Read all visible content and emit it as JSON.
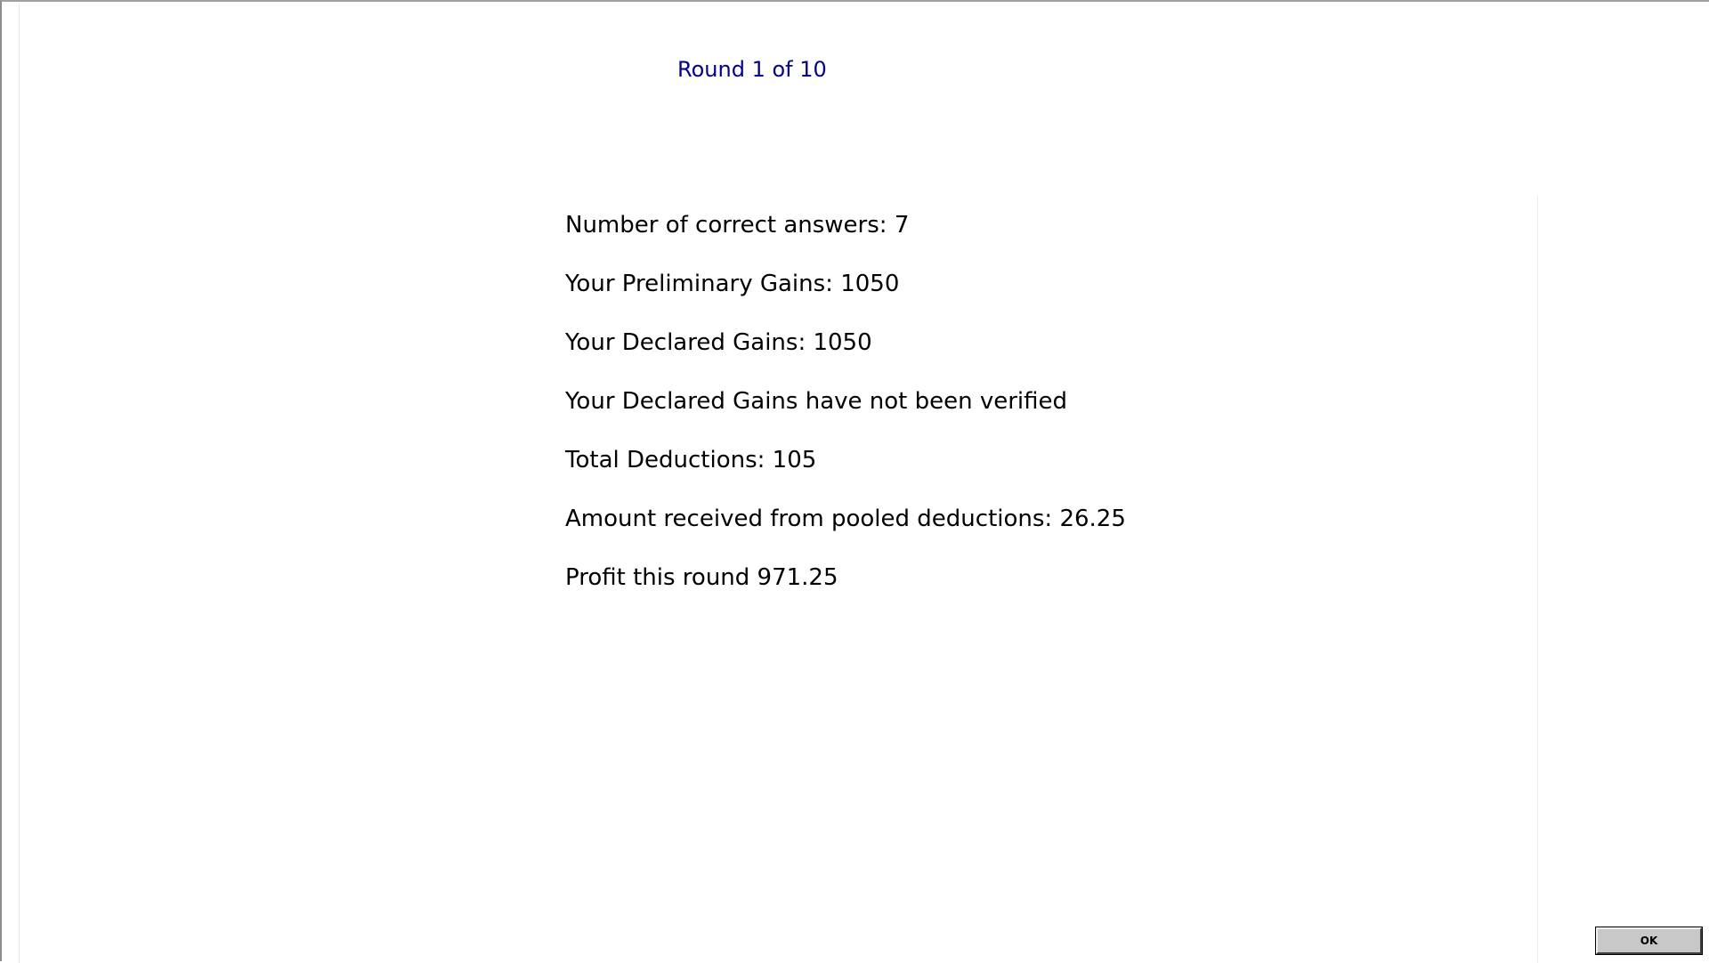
{
  "header": {
    "round_label": "Round 1 of 10"
  },
  "results": {
    "lines": [
      "Number of correct answers: 7",
      "Your Preliminary Gains: 1050",
      "Your Declared Gains: 1050",
      "Your Declared Gains have not been verified",
      "Total Deductions: 105",
      "Amount received from pooled deductions: 26.25",
      "Profit this round 971.25"
    ]
  },
  "footer": {
    "ok_label": "OK"
  },
  "colors": {
    "header_text": "#00008b",
    "body_text": "#000000",
    "button_face": "#c8c8c8"
  }
}
